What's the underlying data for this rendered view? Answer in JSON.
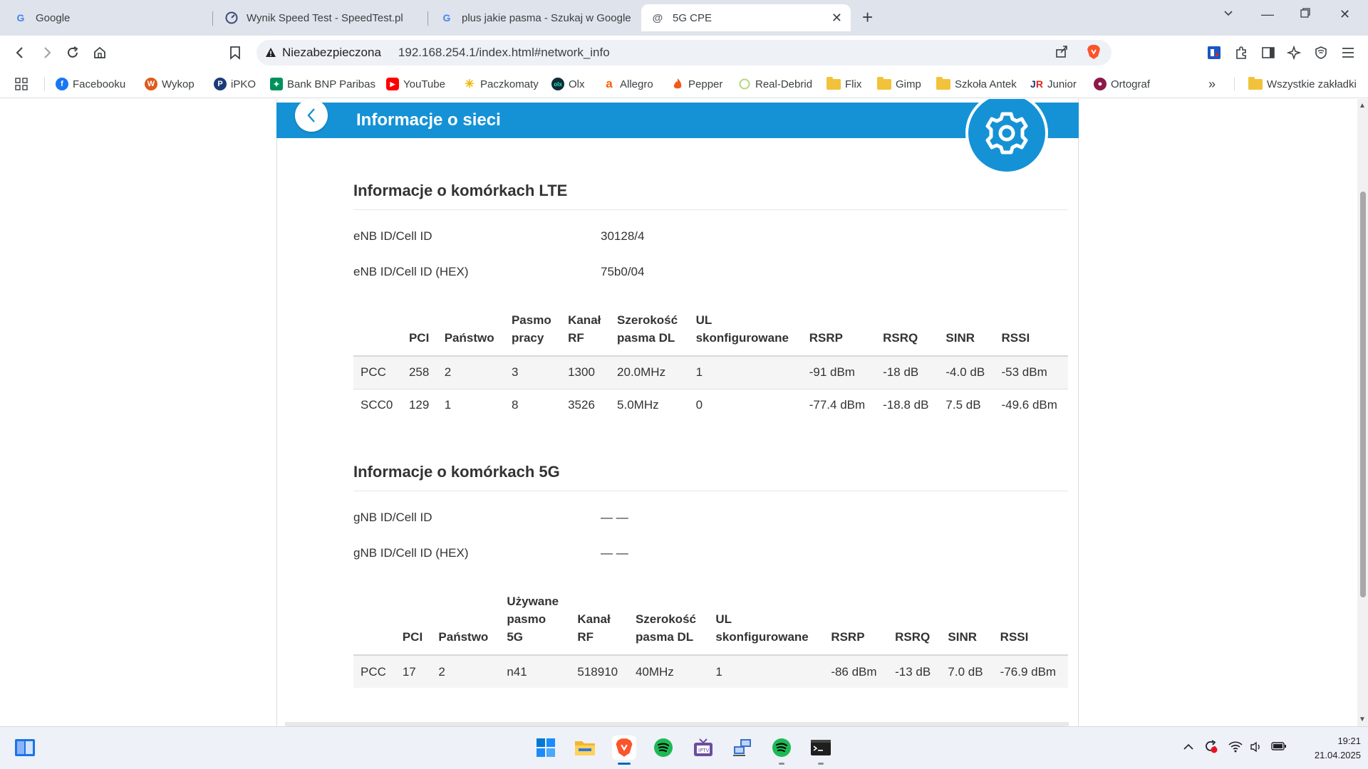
{
  "browser": {
    "tabs": [
      {
        "title": "Google",
        "favicon": "google-icon"
      },
      {
        "title": "Wynik Speed Test - SpeedTest.pl",
        "favicon": "speedtest-icon"
      },
      {
        "title": "plus jakie pasma - Szukaj w Google",
        "favicon": "google-icon"
      },
      {
        "title": "5G CPE",
        "favicon": "router-icon",
        "active": true
      }
    ],
    "security_label": "Niezabezpieczona",
    "url": "192.168.254.1/index.html#network_info",
    "bookmarks": [
      {
        "label": "Facebooku",
        "icon": "facebook-icon",
        "color": "#1877f2"
      },
      {
        "label": "Wykop",
        "icon": "wykop-icon",
        "color": "#e05a1c"
      },
      {
        "label": "iPKO",
        "icon": "pko-icon",
        "color": "#1b3b78"
      },
      {
        "label": "Bank BNP Paribas",
        "icon": "bnp-icon",
        "color": "#00915a"
      },
      {
        "label": "YouTube",
        "icon": "youtube-icon",
        "color": "#ff0000"
      },
      {
        "label": "Paczkomaty",
        "icon": "paczkomaty-icon",
        "color": "#ffcd00"
      },
      {
        "label": "Olx",
        "icon": "olx-icon",
        "color": "#23e5db"
      },
      {
        "label": "Allegro",
        "icon": "allegro-icon",
        "color": "#ff5a00"
      },
      {
        "label": "Pepper",
        "icon": "pepper-icon",
        "color": "#f05a1a"
      },
      {
        "label": "Real-Debrid",
        "icon": "realdebrid-icon",
        "color": "#9acd32"
      },
      {
        "label": "Flix",
        "icon": "folder-icon"
      },
      {
        "label": "Gimp",
        "icon": "folder-icon"
      },
      {
        "label": "Szkoła Antek",
        "icon": "folder-icon"
      },
      {
        "label": "Junior",
        "icon": "junior-icon",
        "color": "#e2231a"
      },
      {
        "label": "Ortograf",
        "icon": "ortograf-icon",
        "color": "#8b1a4a"
      }
    ],
    "all_bookmarks": "Wszystkie zakładki"
  },
  "page": {
    "title": "Informacje o sieci",
    "lte": {
      "title": "Informacje o komórkach LTE",
      "enb_label": "eNB ID/Cell ID",
      "enb_value": "30128/4",
      "enb_hex_label": "eNB ID/Cell ID (HEX)",
      "enb_hex_value": "75b0/04",
      "headers": [
        "",
        "PCI",
        "Państwo",
        "Pasmo\npracy",
        "Kanał\nRF",
        "Szerokość\npasma DL",
        "UL\nskonfigurowane",
        "RSRP",
        "RSRQ",
        "SINR",
        "RSSI"
      ],
      "rows": [
        [
          "PCC",
          "258",
          "2",
          "3",
          "1300",
          "20.0MHz",
          "1",
          "-91 dBm",
          "-18 dB",
          "-4.0 dB",
          "-53 dBm"
        ],
        [
          "SCC0",
          "129",
          "1",
          "8",
          "3526",
          "5.0MHz",
          "0",
          "-77.4 dBm",
          "-18.8 dB",
          "7.5 dB",
          "-49.6 dBm"
        ]
      ]
    },
    "nr": {
      "title": "Informacje o komórkach 5G",
      "gnb_label": "gNB ID/Cell ID",
      "gnb_value": "— —",
      "gnb_hex_label": "gNB ID/Cell ID (HEX)",
      "gnb_hex_value": "— —",
      "headers": [
        "",
        "PCI",
        "Państwo",
        "Używane\npasmo\n5G",
        "Kanał\nRF",
        "Szerokość\npasma DL",
        "UL\nskonfigurowane",
        "RSRP",
        "RSRQ",
        "SINR",
        "RSSI"
      ],
      "rows": [
        [
          "PCC",
          "17",
          "2",
          "n41",
          "518910",
          "40MHz",
          "1",
          "-86 dBm",
          "-13 dB",
          "7.0 dB",
          "-76.9 dBm"
        ]
      ]
    }
  },
  "taskbar": {
    "time": "19:21",
    "date": "21.04.2025"
  },
  "colors": {
    "accent": "#1592d6"
  }
}
